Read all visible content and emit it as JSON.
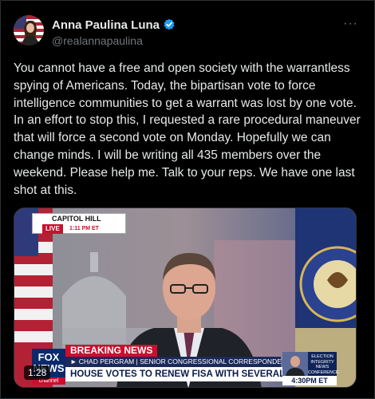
{
  "author": {
    "display_name": "Anna Paulina Luna",
    "handle": "@realannapaulina",
    "verified": true,
    "avatar_icon": "avatar-photo"
  },
  "more_icon": "more-horizontal-icon",
  "tweet": {
    "text": "You cannot have a free and open society with the warrantless spying of Americans. Today, the bipartisan vote to force intelligence communities to get a warrant was lost by one vote. In an effort to stop this, I requested a rare procedural maneuver that will force a second vote on Monday. Hopefully we can change minds. I will be writing all 435 members over the weekend. Please help me. Talk to your reps. We have one last shot at this."
  },
  "video": {
    "location": "CAPITOL HILL",
    "live": "LIVE",
    "live_time": "1:11 PM ET",
    "breaking": "BREAKING NEWS",
    "lower_third_name": "► CHAD PERGRAM | SENIOR CONGRESSIONAL CORRESPONDENT",
    "headline": "HOUSE VOTES TO RENEW FISA WITH SEVERAL AMENDMENTS",
    "network_logo": "FOX NEWS",
    "network_channel": "channel",
    "side_label": "ELECTION INTEGRITY NEWS CONFERENCE",
    "side_time": "4:30PM ET",
    "duration": "1:28"
  },
  "colors": {
    "background": "#000000",
    "text": "#e7e9ea",
    "secondary_text": "#71767b",
    "verified_blue": "#1d9bf0",
    "fox_red": "#c8102e",
    "fox_blue": "#0b2a6b"
  }
}
